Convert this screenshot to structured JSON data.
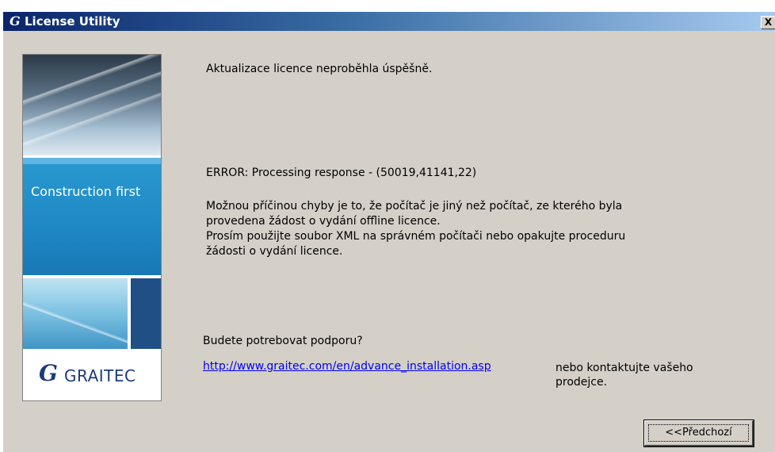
{
  "window": {
    "title": "License Utility",
    "logo_glyph": "G",
    "close_label": "X"
  },
  "banner": {
    "slogan": "Construction first",
    "logo_glyph": "G",
    "logo_text": "GRAITEC"
  },
  "message": {
    "status": "Aktualizace licence neproběhla úspěšně.",
    "error": "ERROR: Processing response - (50019,41141,22)",
    "explanation_lines": [
      "Možnou příčinou chyby je to, že počítač je jiný než počítač, ze kterého byla",
      "provedena žádost o vydání offline licence.",
      "Prosím použijte soubor XML na správném počítači nebo opakujte proceduru",
      "žádosti o vydání licence."
    ]
  },
  "support": {
    "question": "Budete potrebovat podporu?",
    "link": "http://www.graitec.com/en/advance_installation.asp",
    "contact_lines": [
      "nebo kontaktujte vašeho",
      "prodejce."
    ]
  },
  "buttons": {
    "previous": "<<Předchozí"
  },
  "colors": {
    "titlebar_start": "#0a246a",
    "titlebar_end": "#a6caf0",
    "dialog_bg": "#d4d0c8",
    "banner_blue": "#1e88c4",
    "link": "#0000ee"
  }
}
